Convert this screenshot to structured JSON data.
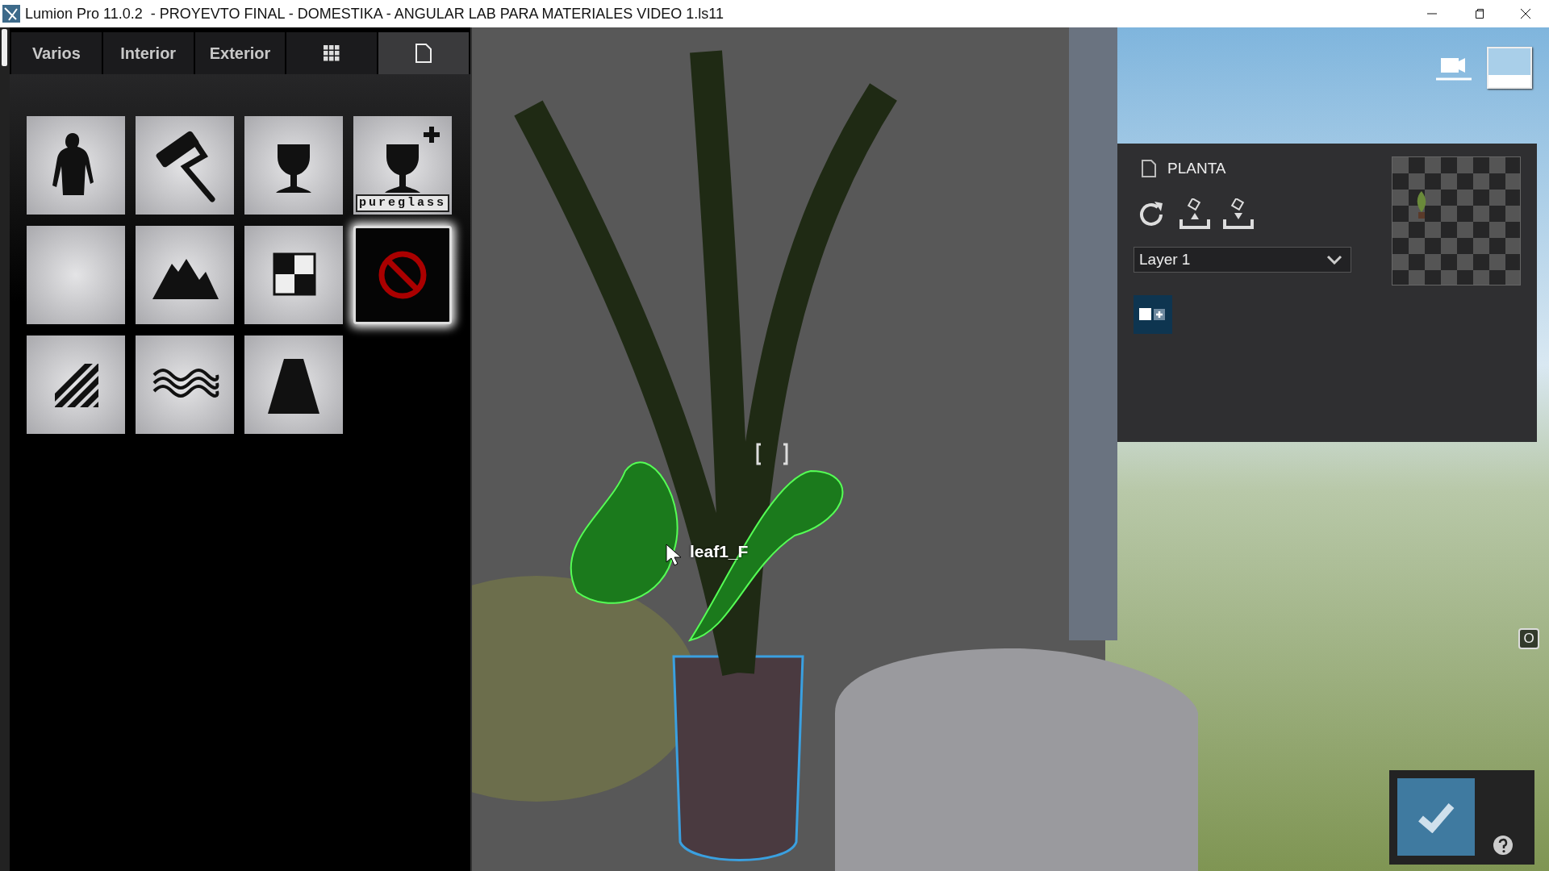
{
  "window": {
    "title": "Lumion Pro 11.0.2  - PROYEVTO FINAL - DOMESTIKA - ANGULAR LAB PARA MATERIALES VIDEO 1.ls11"
  },
  "tabs": [
    {
      "label": "Varios",
      "selected": false
    },
    {
      "label": "Interior",
      "selected": false
    },
    {
      "label": "Exterior",
      "selected": false
    },
    {
      "selected": false
    },
    {
      "selected": true
    }
  ],
  "material_tiles": [
    {
      "selected": false
    },
    {
      "selected": false
    },
    {
      "selected": false
    },
    {
      "label": "pureglass",
      "selected": false
    },
    {
      "selected": false
    },
    {
      "selected": false
    },
    {
      "selected": false
    },
    {
      "selected": true
    },
    {
      "selected": false
    },
    {
      "selected": false
    },
    {
      "selected": false
    }
  ],
  "viewport": {
    "object_label": "leaf1_F",
    "badge": "O"
  },
  "material_panel": {
    "title": "PLANTA",
    "layer_dropdown": {
      "value": "Layer 1"
    }
  }
}
